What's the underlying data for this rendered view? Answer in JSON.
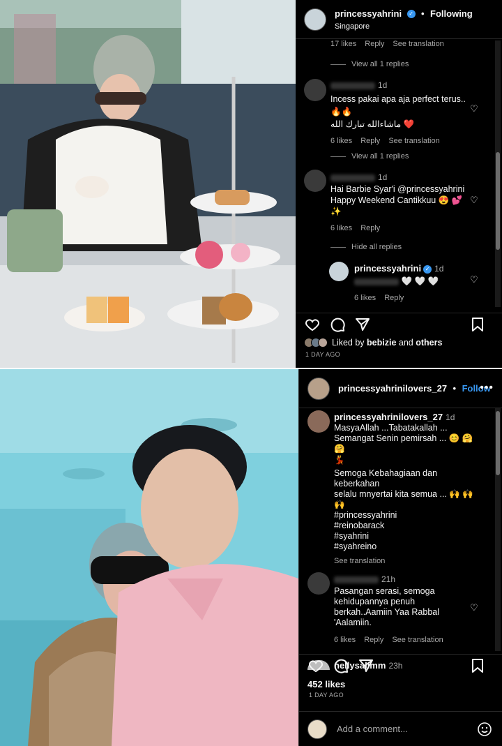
{
  "post1": {
    "header": {
      "username": "princessyahrini",
      "follow_state": "Following",
      "location": "Singapore"
    },
    "top_meta": {
      "likes": "17 likes",
      "reply": "Reply",
      "translation": "See translation"
    },
    "view_replies_1": "View all 1 replies",
    "comment1": {
      "time": "1d",
      "line1": "Incess pakai apa aja perfect terus..",
      "line2": "🔥🔥",
      "line3": "ماشاءالله تبارك الله ❤️",
      "likes": "6 likes",
      "reply": "Reply",
      "translation": "See translation"
    },
    "view_replies_2": "View all 1 replies",
    "comment2": {
      "time": "1d",
      "line1": "Hai Barbie Syar'i @princessyahrini",
      "line2": "Happy Weekend Cantikkuu 😍 💕",
      "line3": "✨",
      "likes": "6 likes",
      "reply": "Reply"
    },
    "hide_replies": "Hide all replies",
    "reply1": {
      "username": "princessyahrini",
      "time": "1d",
      "text": "🤍 🤍 🤍",
      "likes": "6 likes",
      "reply": "Reply"
    },
    "liked_by": {
      "prefix": "Liked by",
      "user": "bebizie",
      "and": "and",
      "others": "others"
    },
    "date": "1 DAY AGO"
  },
  "post2": {
    "header": {
      "username": "princessyahrinilovers_27",
      "follow_label": "Follow"
    },
    "caption": {
      "username": "princessyahrinilovers_27",
      "time": "1d",
      "lines": [
        "MasyaAllah ...Tabatakallah ...",
        "Semangat Senin pemirsah ... 😊 🤗 🤗",
        "💃",
        "Semoga Kebahagiaan dan keberkahan",
        "selalu mnyertai kita semua ... 🙌 🙌 🙌",
        "#princessyahrini",
        "#reinobarack",
        "#syahrini",
        "#syahreino"
      ],
      "translation": "See translation"
    },
    "comment1": {
      "time": "21h",
      "lines": [
        "Pasangan serasi, semoga",
        "kehidupannya penuh",
        "berkah..Aamiin Yaa Rabbal",
        "'Aalamiin."
      ],
      "likes": "6 likes",
      "reply": "Reply",
      "translation": "See translation"
    },
    "comment2_partial": {
      "username": "nellysalimm",
      "time": "23h"
    },
    "likes": "452 likes",
    "date": "1 DAY AGO",
    "add_comment_placeholder": "Add a comment..."
  },
  "colors": {
    "background": "#000000",
    "link": "#3897f0",
    "verified": "#3897f0",
    "muted": "#a8a8a8"
  },
  "icons": [
    "heart-icon",
    "comment-icon",
    "share-icon",
    "save-icon",
    "more-icon",
    "verified-icon",
    "emoji-icon"
  ]
}
